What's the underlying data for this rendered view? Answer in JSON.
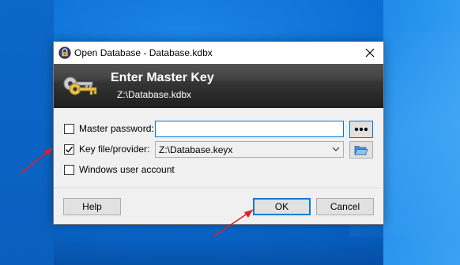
{
  "window": {
    "title": "Open Database - Database.kdbx",
    "app_icon": "keepass-lock-icon",
    "close_icon": "close-icon"
  },
  "banner": {
    "title": "Enter Master Key",
    "subtitle": "Z:\\Database.kdbx",
    "icon": "keys-icon"
  },
  "form": {
    "master_password": {
      "label": "Master password:",
      "checked": false,
      "value": "",
      "reveal_button_icon": "ellipsis-icon"
    },
    "key_file": {
      "label": "Key file/provider:",
      "checked": true,
      "selected_value": "Z:\\Database.keyx",
      "browse_icon": "open-folder-icon"
    },
    "windows_account": {
      "label": "Windows user account",
      "checked": false
    }
  },
  "buttons": {
    "help": "Help",
    "ok": "OK",
    "cancel": "Cancel"
  },
  "colors": {
    "focus_blue": "#0078d7",
    "annotation_red": "#e02020",
    "banner_dark": "#2c2c2c"
  }
}
